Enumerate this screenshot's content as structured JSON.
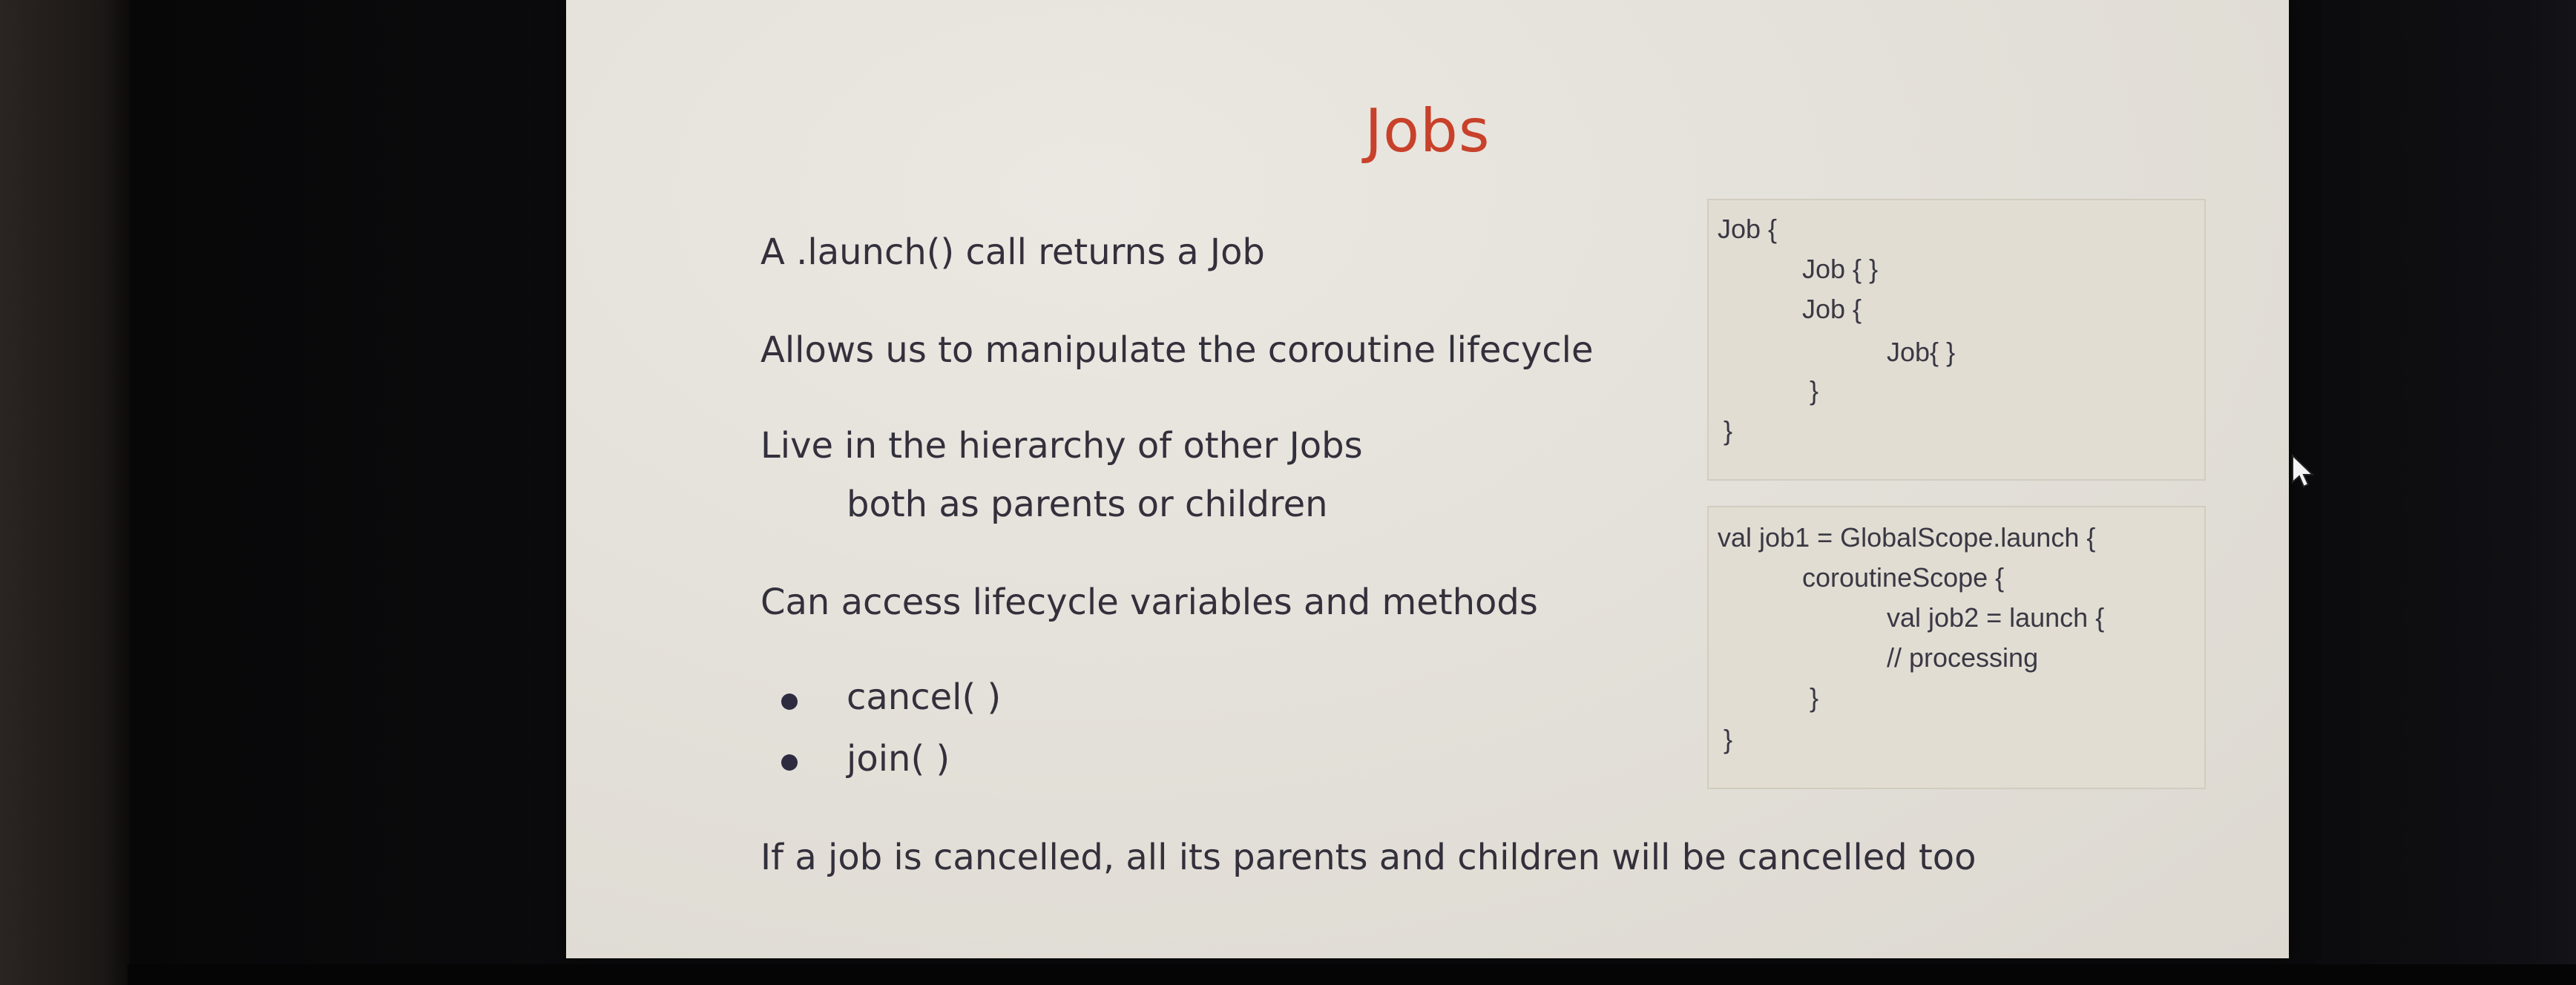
{
  "slide": {
    "title": "Jobs",
    "points": [
      "A .launch() call returns a Job",
      "Allows us to manipulate the coroutine lifecycle",
      "Live in the hierarchy of other Jobs",
      "both as parents or children",
      "Can access lifecycle variables and methods"
    ],
    "bullets": [
      "cancel( )",
      "join( )"
    ],
    "footer": "If a job is cancelled, all its parents and children will be cancelled too"
  },
  "code_box_1": {
    "lines": [
      "Job {",
      "Job { }",
      "Job {",
      "Job{ }",
      "}",
      "}"
    ]
  },
  "code_box_2": {
    "lines": [
      "val job1 = GlobalScope.launch {",
      "coroutineScope {",
      "val job2 = launch {",
      "// processing",
      "}",
      "}"
    ]
  },
  "colors": {
    "title": "#c8412a",
    "body_text": "#33303c",
    "slide_bg": "#e4e1da"
  }
}
